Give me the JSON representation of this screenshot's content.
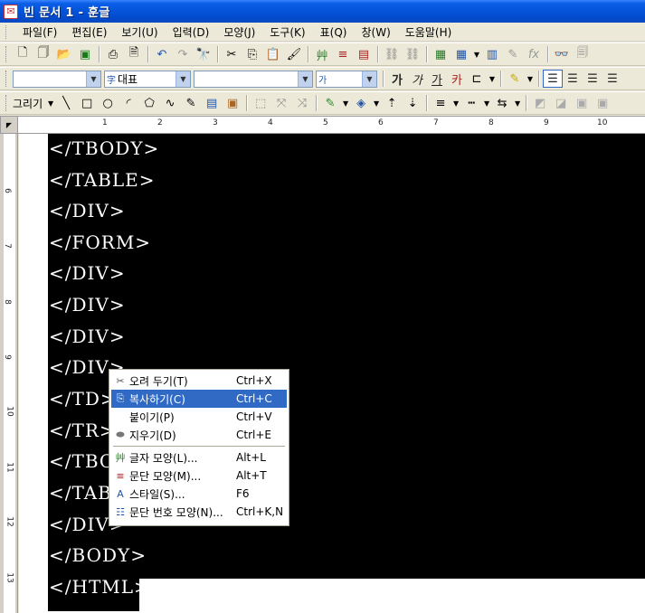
{
  "window": {
    "title": "빈 문서 1 - 훈글",
    "app_icon": "hwp-app-icon"
  },
  "menubar": {
    "items": [
      "파일(F)",
      "편집(E)",
      "보기(U)",
      "입력(D)",
      "모양(J)",
      "도구(K)",
      "표(Q)",
      "창(W)",
      "도움말(H)"
    ]
  },
  "toolbar2": {
    "style_value": "",
    "font_lang_value": "대표",
    "font_value": "",
    "size_value": "",
    "bold_label": "가",
    "italic_label": "가",
    "underline_label": "가",
    "strike_label": "카"
  },
  "toolbar3": {
    "draw_label": "그리기"
  },
  "ruler": {
    "h_numbers": [
      "1",
      "2",
      "3",
      "4",
      "5",
      "6",
      "7",
      "8",
      "9",
      "10"
    ],
    "v_numbers": [
      "6",
      "7",
      "8",
      "9",
      "10",
      "11",
      "12",
      "13"
    ]
  },
  "document": {
    "lines": [
      "</TBODY>",
      "</TABLE>",
      "</DIV>",
      "</FORM>",
      "</DIV>",
      "</DIV>",
      "</DIV>",
      "</DIV>",
      "</TD>",
      "</TR>",
      "</TBO",
      "</TAB",
      "</DIV>",
      "</BODY>",
      "</HTML>"
    ]
  },
  "context_menu": {
    "items": [
      {
        "icon": "scissors-icon",
        "label": "오려 두기(T)",
        "shortcut": "Ctrl+X",
        "highlighted": false
      },
      {
        "icon": "copy-icon",
        "label": "복사하기(C)",
        "shortcut": "Ctrl+C",
        "highlighted": true
      },
      {
        "icon": "",
        "label": "붙이기(P)",
        "shortcut": "Ctrl+V",
        "highlighted": false
      },
      {
        "icon": "eraser-icon",
        "label": "지우기(D)",
        "shortcut": "Ctrl+E",
        "highlighted": false
      },
      {
        "icon": "char-shape-icon",
        "label": "글자 모양(L)...",
        "shortcut": "Alt+L",
        "highlighted": false
      },
      {
        "icon": "para-shape-icon",
        "label": "문단 모양(M)...",
        "shortcut": "Alt+T",
        "highlighted": false
      },
      {
        "icon": "style-icon",
        "label": "스타일(S)...",
        "shortcut": "F6",
        "highlighted": false
      },
      {
        "icon": "numbering-icon",
        "label": "문단 번호 모양(N)...",
        "shortcut": "Ctrl+K,N",
        "highlighted": false
      }
    ]
  },
  "colors": {
    "selection": "#000000",
    "menu_highlight": "#316ac5",
    "titlebar": "#0553d8"
  }
}
